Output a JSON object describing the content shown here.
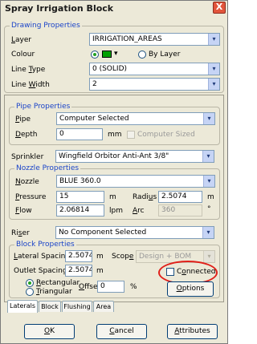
{
  "window": {
    "title": "Spray Irrigation Block",
    "close_glyph": "X"
  },
  "drawing": {
    "legend": "Drawing Properties",
    "layer_label": "Layer",
    "layer_value": "IRRIGATION_AREAS",
    "colour_label": "Colour",
    "colour_swatch": "#00a000",
    "by_layer_label": "By Layer",
    "linetype_label": "Line Type",
    "linetype_value": "0 (SOLID)",
    "linewidth_label": "Line Width",
    "linewidth_value": "2"
  },
  "pipe": {
    "legend": "Pipe Properties",
    "pipe_label": "Pipe",
    "pipe_value": "Computer Selected",
    "depth_label": "Depth",
    "depth_value": "0",
    "depth_unit": "mm",
    "computer_sized_label": "Computer Sized"
  },
  "sprinkler": {
    "label": "Sprinkler",
    "value": "Wingfield Orbitor Anti-Ant 3/8\""
  },
  "nozzle": {
    "legend": "Nozzle Properties",
    "nozzle_label": "Nozzle",
    "nozzle_value": "BLUE 360.0",
    "pressure_label": "Pressure",
    "pressure_value": "15",
    "pressure_unit": "m",
    "radius_label": "Radius",
    "radius_value": "2.5074",
    "radius_unit": "m",
    "flow_label": "Flow",
    "flow_value": "2.06814",
    "flow_unit": "lpm",
    "arc_label": "Arc",
    "arc_value": "360",
    "arc_unit": "°"
  },
  "riser": {
    "label": "Riser",
    "value": "No Component Selected"
  },
  "block": {
    "legend": "Block Properties",
    "lateral_label": "Lateral Spacing",
    "lateral_value": "2.5074",
    "lateral_unit": "m",
    "scope_label": "Scope",
    "scope_value": "Design + BOM",
    "outlet_label": "Outlet Spacing",
    "outlet_value": "2.5074",
    "outlet_unit": "m",
    "connected_label": "Connected",
    "rectangular_label": "Rectangular",
    "triangular_label": "Triangular",
    "offset_label": "Offset",
    "offset_value": "0",
    "offset_unit": "%",
    "options_label": "Options"
  },
  "tabs": [
    "Laterals",
    "Block",
    "Flushing",
    "Area"
  ],
  "buttons": {
    "ok": "OK",
    "cancel": "Cancel",
    "attributes": "Attributes"
  },
  "icons": {
    "dropdown": "▾"
  },
  "colors": {
    "legend_blue": "#1b44c8",
    "highlight_red": "#e0201a",
    "radio_green": "#21a121"
  }
}
